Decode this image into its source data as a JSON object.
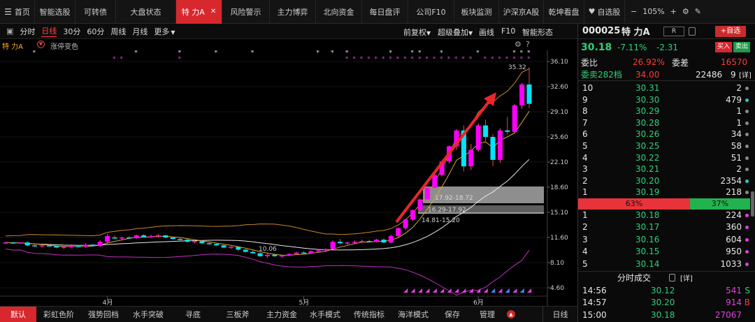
{
  "topnav": {
    "menu_icon": "menu-icon",
    "tabs": [
      "首页",
      "智能选股",
      "可转债",
      "大盘状态",
      "特 力A",
      "风险警示",
      "主力博弈",
      "北向资金",
      "每日盘评",
      "公司F10",
      "板块监测",
      "沪深京A股",
      "乾坤看盘"
    ],
    "close_glyph": "✕",
    "favorites_label": "自选股",
    "zoom": "105%"
  },
  "toolbar": {
    "left": [
      "分时",
      "日线",
      "30分",
      "60分",
      "周线",
      "月线",
      "更多"
    ],
    "right": [
      "前复权",
      "超级叠加",
      "画线",
      "F10",
      "智能形态"
    ]
  },
  "infoline": {
    "name": "特 力A",
    "option": "涨停变色"
  },
  "chart_data": {
    "type": "candlestick",
    "stock": "特 力A",
    "y_ticks": [
      "36.10",
      "32.60",
      "29.10",
      "25.60",
      "22.10",
      "18.60",
      "15.10",
      "11.60",
      "8.10",
      "4.60"
    ],
    "x_ticks": [
      "4月",
      "5月",
      "6月"
    ],
    "annotations": [
      "35.32",
      "10.06",
      "17.92-18.72",
      "16.29-17.92",
      "14.81-15.20"
    ],
    "price_range": [
      4.6,
      36.1
    ],
    "candles": [
      [
        10.9,
        11.0,
        10.7,
        10.9
      ],
      [
        10.9,
        11.0,
        10.7,
        10.8
      ],
      [
        10.8,
        10.9,
        10.7,
        10.9
      ],
      [
        10.9,
        11.1,
        10.4,
        10.5
      ],
      [
        10.5,
        10.6,
        10.3,
        10.4
      ],
      [
        10.4,
        10.6,
        10.2,
        10.5
      ],
      [
        10.5,
        10.7,
        10.3,
        10.4
      ],
      [
        10.4,
        10.5,
        10.1,
        10.2
      ],
      [
        10.2,
        10.4,
        10.0,
        10.3
      ],
      [
        10.3,
        10.5,
        10.1,
        10.4
      ],
      [
        10.4,
        10.6,
        10.2,
        10.3
      ],
      [
        10.3,
        10.8,
        10.2,
        10.6
      ],
      [
        10.6,
        10.7,
        10.3,
        10.4
      ],
      [
        10.4,
        11.2,
        10.3,
        11.0
      ],
      [
        11.0,
        12.1,
        10.8,
        11.8
      ],
      [
        11.6,
        11.9,
        11.4,
        11.5
      ],
      [
        11.5,
        11.7,
        11.3,
        11.6
      ],
      [
        11.6,
        11.8,
        11.4,
        11.5
      ],
      [
        11.5,
        12.0,
        11.4,
        11.9
      ],
      [
        11.9,
        12.1,
        11.6,
        11.7
      ],
      [
        11.7,
        12.0,
        11.5,
        11.8
      ],
      [
        11.8,
        12.1,
        11.6,
        11.9
      ],
      [
        11.9,
        12.0,
        11.5,
        11.6
      ],
      [
        11.6,
        11.7,
        11.3,
        11.4
      ],
      [
        11.4,
        11.6,
        11.2,
        11.3
      ],
      [
        11.3,
        11.4,
        10.9,
        11.0
      ],
      [
        11.0,
        11.2,
        10.8,
        11.1
      ],
      [
        11.1,
        11.2,
        10.7,
        10.8
      ],
      [
        10.8,
        11.0,
        10.6,
        10.7
      ],
      [
        10.7,
        10.8,
        10.4,
        10.5
      ],
      [
        10.5,
        10.6,
        10.1,
        10.2
      ],
      [
        10.2,
        10.4,
        10.0,
        10.3
      ],
      [
        10.3,
        10.4,
        9.7,
        9.9
      ],
      [
        9.9,
        10.0,
        9.5,
        9.6
      ],
      [
        9.6,
        9.8,
        9.3,
        9.4
      ],
      [
        9.4,
        9.5,
        8.9,
        9.0
      ],
      [
        9.0,
        9.3,
        8.8,
        9.2
      ],
      [
        9.2,
        9.4,
        8.9,
        9.0
      ],
      [
        9.0,
        9.2,
        8.8,
        9.1
      ],
      [
        9.1,
        9.4,
        9.0,
        9.3
      ],
      [
        9.3,
        9.6,
        9.2,
        9.5
      ],
      [
        9.5,
        9.7,
        9.3,
        9.4
      ],
      [
        9.4,
        9.8,
        9.3,
        9.7
      ],
      [
        9.7,
        9.9,
        9.5,
        9.8
      ],
      [
        9.8,
        10.1,
        9.6,
        10.0
      ],
      [
        10.0,
        11.2,
        9.9,
        11.0
      ],
      [
        11.0,
        11.4,
        10.7,
        10.8
      ],
      [
        10.8,
        11.0,
        10.6,
        10.9
      ],
      [
        10.9,
        11.2,
        10.7,
        11.0
      ],
      [
        11.0,
        11.3,
        10.8,
        11.1
      ],
      [
        11.1,
        11.3,
        10.9,
        11.0
      ],
      [
        11.0,
        11.4,
        10.9,
        11.3
      ],
      [
        11.3,
        11.5,
        10.8,
        10.9
      ],
      [
        10.9,
        12.0,
        10.8,
        11.8
      ],
      [
        11.8,
        13.0,
        11.6,
        12.9
      ],
      [
        12.9,
        14.2,
        12.7,
        14.1
      ],
      [
        14.1,
        15.5,
        13.9,
        15.4
      ],
      [
        15.4,
        17.0,
        15.2,
        16.9
      ],
      [
        16.9,
        18.6,
        16.8,
        18.5
      ],
      [
        18.5,
        20.4,
        18.4,
        20.3
      ],
      [
        20.3,
        22.3,
        20.1,
        22.2
      ],
      [
        22.2,
        24.4,
        21.9,
        24.3
      ],
      [
        24.3,
        26.7,
        23.8,
        26.5
      ],
      [
        26.5,
        27.2,
        20.8,
        21.5
      ],
      [
        21.5,
        24.6,
        21.0,
        23.8
      ],
      [
        23.8,
        27.5,
        23.5,
        27.2
      ],
      [
        27.2,
        28.0,
        25.0,
        25.6
      ],
      [
        25.6,
        26.0,
        21.5,
        22.4
      ],
      [
        22.4,
        26.8,
        22.0,
        26.5
      ],
      [
        26.5,
        28.4,
        25.9,
        26.3
      ],
      [
        26.3,
        30.2,
        26.1,
        30.0
      ],
      [
        30.0,
        33.1,
        29.5,
        32.9
      ],
      [
        32.9,
        35.3,
        29.6,
        30.2
      ]
    ]
  },
  "bottomtabs": [
    "默认",
    "彩虹色阶",
    "强势回档",
    "水手突破",
    "寻底",
    "三板斧",
    "主力资金",
    "水手模式",
    "传统指标",
    "海洋模式",
    "保存",
    "管理"
  ],
  "bottom_right": "日线",
  "quote": {
    "code": "000025",
    "name": "特 力A",
    "r_badge": "R",
    "add_fav": "+自选",
    "price": "30.18",
    "change_pct": "-7.11%",
    "change": "-2.31",
    "buy_label": "买入",
    "sell_label": "卖出",
    "weibi_label": "委比",
    "weibi": "26.92%",
    "weicha_label": "委差",
    "weicha": "16570",
    "sell_queue_label": "委卖282档",
    "sell_queue_price": "34.00",
    "sell_queue_vol": "22486",
    "sell_queue_n": "9",
    "detail": "[详]",
    "asks": [
      {
        "lvl": "10",
        "price": "30.31",
        "vol": "2",
        "dot": "#8a8a8a"
      },
      {
        "lvl": "9",
        "price": "30.30",
        "vol": "479",
        "dot": "#2ec7c7"
      },
      {
        "lvl": "8",
        "price": "30.29",
        "vol": "1",
        "dot": "#8a8a8a"
      },
      {
        "lvl": "7",
        "price": "30.28",
        "vol": "1",
        "dot": "#8a8a8a"
      },
      {
        "lvl": "6",
        "price": "30.26",
        "vol": "34",
        "dot": "#8a8a8a"
      },
      {
        "lvl": "5",
        "price": "30.25",
        "vol": "58",
        "dot": "#8a8a8a"
      },
      {
        "lvl": "4",
        "price": "30.22",
        "vol": "51",
        "dot": "#8a8a8a"
      },
      {
        "lvl": "3",
        "price": "30.21",
        "vol": "2",
        "dot": "#8a8a8a"
      },
      {
        "lvl": "2",
        "price": "30.20",
        "vol": "2354",
        "dot": "#2ec7c7"
      },
      {
        "lvl": "1",
        "price": "30.19",
        "vol": "218",
        "dot": "#8a8a8a"
      }
    ],
    "ratio_sell": "63%",
    "ratio_buy": "37%",
    "ratio_sell_frac": 0.63,
    "bids": [
      {
        "lvl": "1",
        "price": "30.18",
        "vol": "224",
        "dot": "#e040e0"
      },
      {
        "lvl": "2",
        "price": "30.17",
        "vol": "360",
        "dot": "#e040e0"
      },
      {
        "lvl": "3",
        "price": "30.16",
        "vol": "604",
        "dot": "#e040e0"
      },
      {
        "lvl": "4",
        "price": "30.15",
        "vol": "950",
        "dot": "#e040e0"
      },
      {
        "lvl": "5",
        "price": "30.14",
        "vol": "1033",
        "dot": "#e040e0"
      }
    ],
    "trades_title": "分时成交",
    "trades_detail": "[详]",
    "trades": [
      {
        "time": "14:56",
        "price": "30.12",
        "vol": "541",
        "side": "S"
      },
      {
        "time": "14:57",
        "price": "30.20",
        "vol": "914",
        "side": "B"
      },
      {
        "time": "15:00",
        "price": "30.18",
        "vol": "27067",
        "side": ""
      }
    ]
  },
  "colors": {
    "up": "#ff3a3a",
    "down": "#2fd07a",
    "accent": "#d8272d",
    "rise_candle": "#ff00ff",
    "fall_candle": "#00e5ff"
  }
}
